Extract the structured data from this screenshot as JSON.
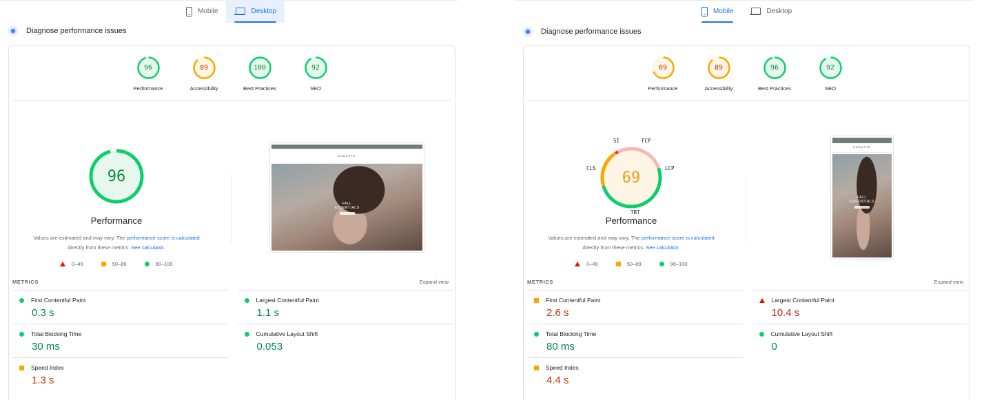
{
  "desktop": {
    "tabs": [
      {
        "label": "Mobile",
        "icon": "phone-icon",
        "active": false
      },
      {
        "label": "Desktop",
        "icon": "laptop-icon",
        "active": true
      }
    ],
    "header_title": "Diagnose performance issues",
    "categories": [
      {
        "score": 96,
        "label": "Performance",
        "status": "pass"
      },
      {
        "score": 89,
        "label": "Accessibility",
        "status": "average"
      },
      {
        "score": 100,
        "label": "Best Practices",
        "status": "pass"
      },
      {
        "score": 92,
        "label": "SEO",
        "status": "pass"
      }
    ],
    "performance_score": 96,
    "performance_label": "Performance",
    "note_prefix": "Values are estimated and may vary. The ",
    "note_link1": "performance score is calculated",
    "note_middle": "directly from these metrics. ",
    "note_link2": "See calculator.",
    "legend": [
      "0–49",
      "50–89",
      "90–100"
    ],
    "metrics_title": "METRICS",
    "expand_label": "Expand view",
    "metrics": [
      {
        "name": "First Contentful Paint",
        "value": "0.3 s",
        "status": "pass"
      },
      {
        "name": "Largest Contentful Paint",
        "value": "1.1 s",
        "status": "pass"
      },
      {
        "name": "Total Blocking Time",
        "value": "30 ms",
        "status": "pass"
      },
      {
        "name": "Cumulative Layout Shift",
        "value": "0.053",
        "status": "pass"
      },
      {
        "name": "Speed Index",
        "value": "1.3 s",
        "status": "pass"
      }
    ],
    "screenshot": {
      "brand": "SUNUTTE",
      "hero_line1": "FALL",
      "hero_line2": "ESSENTIALS"
    }
  },
  "mobile": {
    "tabs": [
      {
        "label": "Mobile",
        "icon": "phone-icon",
        "active": true
      },
      {
        "label": "Desktop",
        "icon": "laptop-icon",
        "active": false
      }
    ],
    "header_title": "Diagnose performance issues",
    "categories": [
      {
        "score": 69,
        "label": "Performance",
        "status": "average"
      },
      {
        "score": 89,
        "label": "Accessibility",
        "status": "average"
      },
      {
        "score": 96,
        "label": "Best Practices",
        "status": "pass"
      },
      {
        "score": 92,
        "label": "SEO",
        "status": "pass"
      }
    ],
    "performance_score": 69,
    "performance_label": "Performance",
    "arc_labels": {
      "si": "SI",
      "fcp": "FCP",
      "lcp": "LCP",
      "tbt": "TBT",
      "cls": "CLS"
    },
    "note_prefix": "Values are estimated and may vary. The ",
    "note_link1": "performance score is calculated",
    "note_middle": "directly from these metrics. ",
    "note_link2": "See calculator.",
    "legend": [
      "0–49",
      "50–89",
      "90–100"
    ],
    "metrics_title": "METRICS",
    "expand_label": "Expand view",
    "metrics": [
      {
        "name": "First Contentful Paint",
        "value": "2.6 s",
        "status": "average"
      },
      {
        "name": "Largest Contentful Paint",
        "value": "10.4 s",
        "status": "fail"
      },
      {
        "name": "Total Blocking Time",
        "value": "80 ms",
        "status": "pass"
      },
      {
        "name": "Cumulative Layout Shift",
        "value": "0",
        "status": "pass"
      },
      {
        "name": "Speed Index",
        "value": "4.4 s",
        "status": "average"
      }
    ],
    "screenshot": {
      "brand": "SUNUTTE",
      "hero_line1": "FALL",
      "hero_line2": "ESSENTIALS"
    }
  },
  "colors": {
    "pass": "#0cce6b",
    "average": "#ffa400",
    "fail": "#ff4e42",
    "accent": "#1a73e8"
  }
}
